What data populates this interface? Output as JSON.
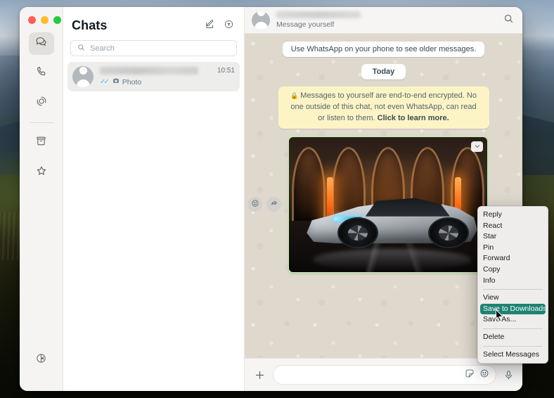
{
  "window": {
    "traffic_lights": [
      "close",
      "minimize",
      "maximize"
    ],
    "colors": {
      "close": "#ff5f57",
      "minimize": "#febc2e",
      "maximize": "#28c840",
      "accent": "#1f8274",
      "bubble_border": "#c9e6b6",
      "encrypt_bg": "#fdf4c5"
    }
  },
  "nav_rail": {
    "items": [
      {
        "name": "chats",
        "icon": "chats-icon",
        "active": true
      },
      {
        "name": "calls",
        "icon": "phone-icon",
        "active": false
      },
      {
        "name": "status",
        "icon": "status-icon",
        "active": false
      },
      {
        "name": "archived",
        "icon": "archive-icon",
        "active": false
      },
      {
        "name": "starred",
        "icon": "star-icon",
        "active": false
      }
    ],
    "bottom": {
      "name": "settings",
      "icon": "settings-icon"
    }
  },
  "chat_list": {
    "title": "Chats",
    "actions": [
      {
        "name": "new-chat",
        "icon": "compose-icon"
      },
      {
        "name": "filter-chats",
        "icon": "filter-circle-icon"
      }
    ],
    "search": {
      "placeholder": "Search",
      "value": "",
      "icon": "search-icon"
    },
    "rows": [
      {
        "name_redacted": true,
        "status_icon": "double-check-icon",
        "attachment_icon": "camera-icon",
        "preview": "Photo",
        "time": "10:51",
        "selected": true
      }
    ]
  },
  "conversation": {
    "header": {
      "name_redacted": true,
      "subtitle": "Message yourself",
      "search_icon": "search-icon",
      "avatar": "default-avatar"
    },
    "system_messages": [
      {
        "type": "info",
        "text": "Use WhatsApp on your phone to see older messages."
      },
      {
        "type": "day",
        "text": "Today"
      }
    ],
    "encryption_notice": {
      "lock_icon": "lock-icon",
      "text": "Messages to yourself are end-to-end encrypted. No one outside of this chat, not even WhatsApp, can read or listen to them.",
      "link_text": "Click to learn more."
    },
    "image_message": {
      "description": "Futuristic silver sports car in an arched colonnade with orange lighting",
      "menu_icon": "chevron-down-icon",
      "hover_actions": [
        {
          "name": "react",
          "icon": "emoji-icon"
        },
        {
          "name": "forward",
          "icon": "forward-arrow-icon"
        }
      ]
    },
    "composer": {
      "attach_icon": "plus-icon",
      "placeholder": "",
      "value": "",
      "right_icons": [
        {
          "name": "sticker",
          "icon": "sticker-icon"
        },
        {
          "name": "emoji",
          "icon": "emoji-icon"
        }
      ],
      "mic_icon": "microphone-icon"
    }
  },
  "context_menu": {
    "groups": [
      {
        "items": [
          {
            "label": "Reply",
            "highlighted": false
          },
          {
            "label": "React",
            "highlighted": false
          },
          {
            "label": "Star",
            "highlighted": false
          },
          {
            "label": "Pin",
            "highlighted": false
          },
          {
            "label": "Forward",
            "highlighted": false
          },
          {
            "label": "Copy",
            "highlighted": false
          },
          {
            "label": "Info",
            "highlighted": false
          }
        ]
      },
      {
        "items": [
          {
            "label": "View",
            "highlighted": false
          },
          {
            "label": "Save to Downloads",
            "highlighted": true
          },
          {
            "label": "Save As...",
            "highlighted": false
          }
        ]
      },
      {
        "items": [
          {
            "label": "Delete",
            "highlighted": false
          }
        ]
      },
      {
        "items": [
          {
            "label": "Select Messages",
            "highlighted": false
          }
        ]
      }
    ]
  }
}
